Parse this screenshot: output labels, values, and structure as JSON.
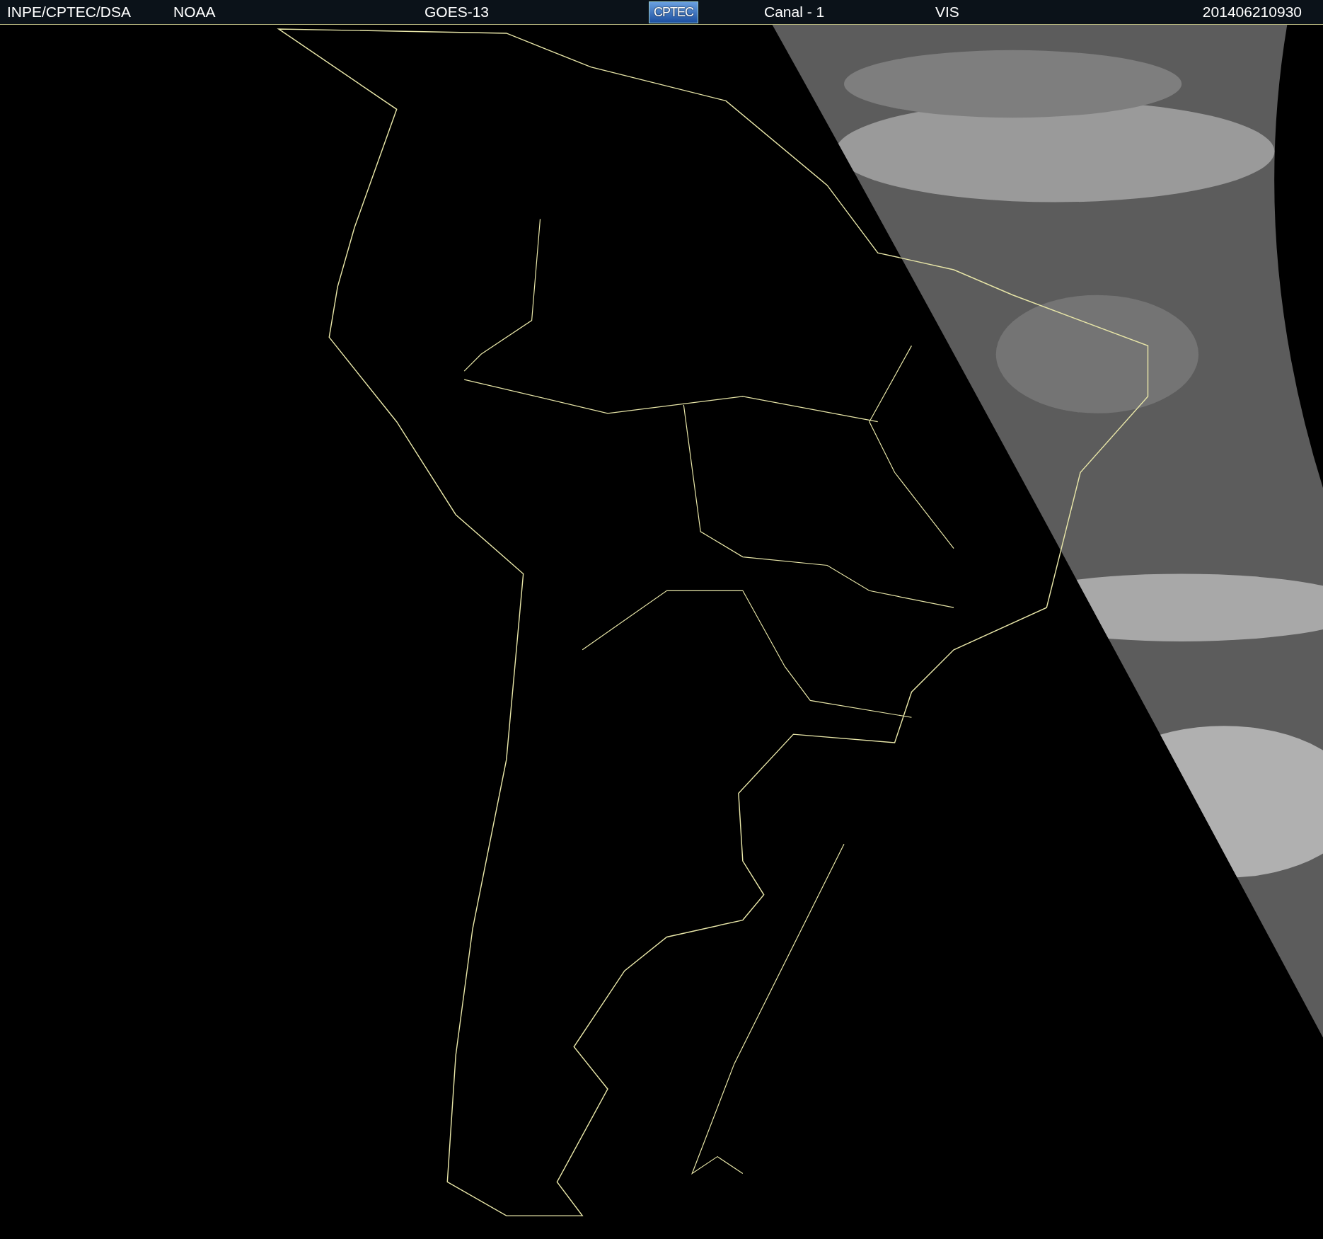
{
  "header": {
    "items": [
      {
        "kind": "text",
        "text": "INPE/CPTEC/DSA"
      },
      {
        "kind": "text",
        "text": "NOAA"
      },
      {
        "kind": "text",
        "text": "GOES-13"
      },
      {
        "kind": "logo",
        "text": "CPTEC"
      },
      {
        "kind": "text",
        "text": "Canal - 1"
      },
      {
        "kind": "text",
        "text": "VIS"
      },
      {
        "kind": "text",
        "text": "201406210930"
      }
    ]
  }
}
